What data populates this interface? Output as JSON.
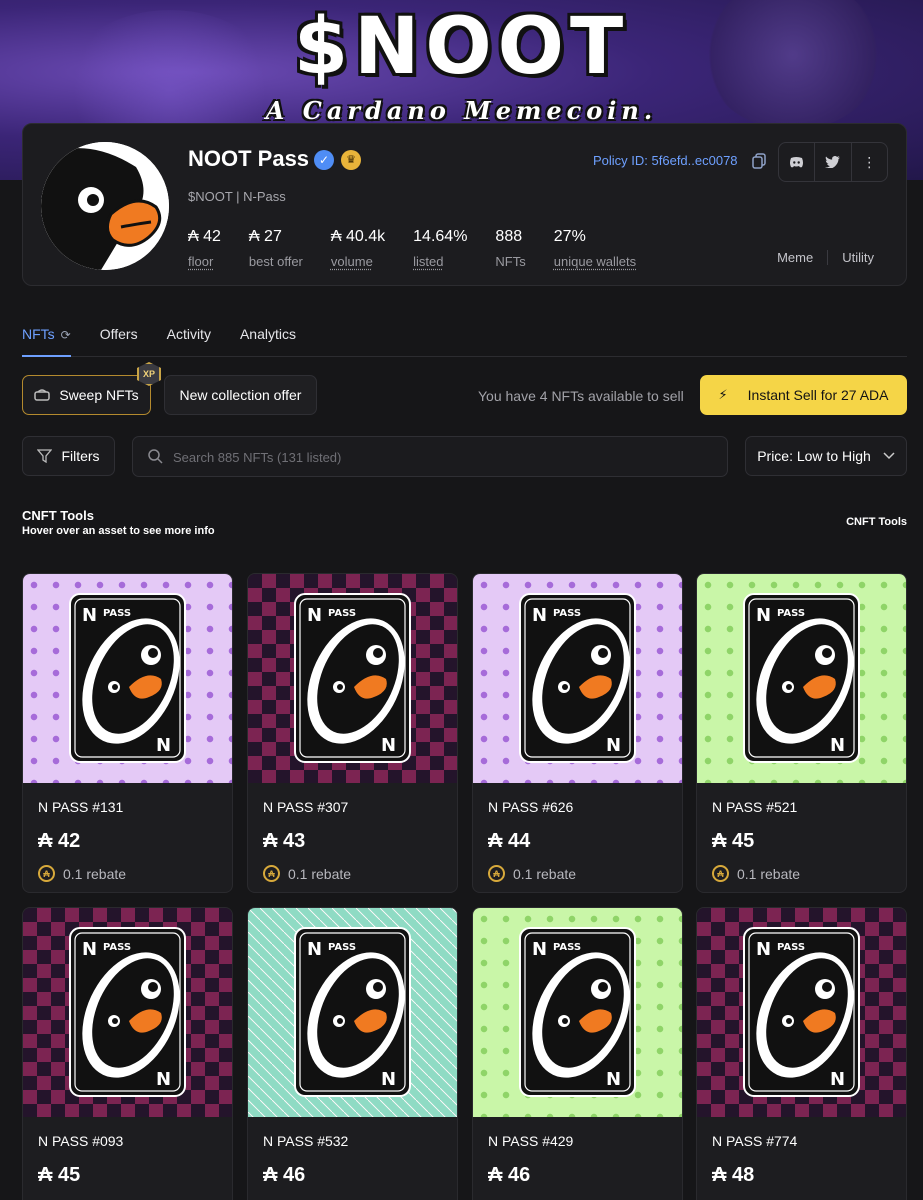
{
  "banner": {
    "title": "$NOOT",
    "subtitle": "A Cardano Memecoin."
  },
  "collection": {
    "name": "NOOT Pass",
    "subtitle": "$NOOT | N-Pass",
    "policy": "Policy ID: 5f6efd..ec0078",
    "stats": [
      {
        "value": "₳ 42",
        "label": "floor"
      },
      {
        "value": "₳ 27",
        "label": "best offer"
      },
      {
        "value": "₳ 40.4k",
        "label": "volume"
      },
      {
        "value": "14.64%",
        "label": "listed"
      },
      {
        "value": "888",
        "label": "NFTs"
      },
      {
        "value": "27%",
        "label": "unique wallets"
      }
    ],
    "tags": [
      "Meme",
      "Utility"
    ]
  },
  "tabs": [
    "NFTs",
    "Offers",
    "Activity",
    "Analytics"
  ],
  "actions": {
    "sweep": "Sweep NFTs",
    "xp": "XP",
    "new_offer": "New collection offer",
    "available": "You have 4 NFTs available to sell",
    "instant_sell": "Instant Sell for 27 ADA"
  },
  "filter_bar": {
    "filters": "Filters",
    "search_placeholder": "Search 885 NFTs (131 listed)",
    "sort": "Price: Low to High"
  },
  "tools": {
    "title": "CNFT Tools",
    "hint": "Hover over an asset to see more info",
    "link": "CNFT Tools"
  },
  "nfts": [
    {
      "name": "N PASS #131",
      "price": "₳ 42",
      "rebate": "0.1 rebate",
      "bg": "purple"
    },
    {
      "name": "N PASS #307",
      "price": "₳ 43",
      "rebate": "0.1 rebate",
      "bg": "argyle"
    },
    {
      "name": "N PASS #626",
      "price": "₳ 44",
      "rebate": "0.1 rebate",
      "bg": "purple"
    },
    {
      "name": "N PASS #521",
      "price": "₳ 45",
      "rebate": "0.1 rebate",
      "bg": "green"
    },
    {
      "name": "N PASS #093",
      "price": "₳ 45",
      "rebate": "",
      "bg": "argyle"
    },
    {
      "name": "N PASS #532",
      "price": "₳ 46",
      "rebate": "",
      "bg": "teal"
    },
    {
      "name": "N PASS #429",
      "price": "₳ 46",
      "rebate": "",
      "bg": "green"
    },
    {
      "name": "N PASS #774",
      "price": "₳ 48",
      "rebate": "",
      "bg": "argyle"
    }
  ],
  "pass_card": {
    "top_label": "PASS",
    "corner": "N"
  }
}
